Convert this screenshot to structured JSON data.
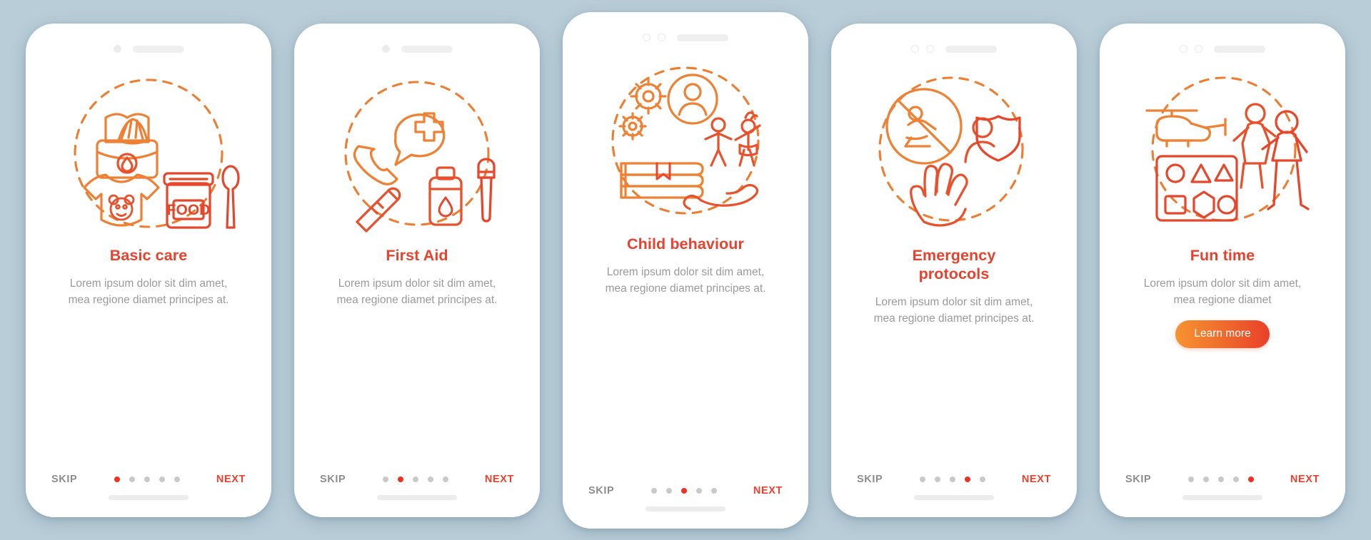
{
  "page": {
    "background_color": "#b8cdd8",
    "accent_color": "#e8422e",
    "muted_text_color": "#9a9a9a",
    "dot_active_color": "#ee3124",
    "dot_inactive_color": "#c9c9c9"
  },
  "common": {
    "skip_label": "SKIP",
    "next_label": "NEXT",
    "description": "Lorem ipsum dolor sit dim amet, mea regione diamet principes at.",
    "total_steps": 5
  },
  "screens": [
    {
      "index": 1,
      "title": "Basic care",
      "description": "Lorem ipsum dolor sit dim amet, mea regione diamet principes at.",
      "skip_label": "SKIP",
      "next_label": "NEXT",
      "active_dot": 1,
      "illustration": "baby-care-icon",
      "notch_style": "one-dot",
      "cta": null
    },
    {
      "index": 2,
      "title": "First Aid",
      "description": "Lorem ipsum dolor sit dim amet, mea regione diamet principes at.",
      "skip_label": "SKIP",
      "next_label": "NEXT",
      "active_dot": 2,
      "illustration": "first-aid-icon",
      "notch_style": "one-dot",
      "cta": null
    },
    {
      "index": 3,
      "title": "Child behaviour",
      "description": "Lorem ipsum dolor sit dim amet, mea regione diamet principes at.",
      "skip_label": "SKIP",
      "next_label": "NEXT",
      "active_dot": 3,
      "illustration": "child-behaviour-icon",
      "notch_style": "two-dots",
      "cta": null
    },
    {
      "index": 4,
      "title": "Emergency protocols",
      "description": "Lorem ipsum dolor sit dim amet, mea regione diamet principes at.",
      "skip_label": "SKIP",
      "next_label": "NEXT",
      "active_dot": 4,
      "illustration": "emergency-protocols-icon",
      "notch_style": "two-dots",
      "cta": null
    },
    {
      "index": 5,
      "title": "Fun time",
      "description": "Lorem ipsum dolor sit dim amet, mea regione diamet",
      "skip_label": "SKIP",
      "next_label": "NEXT",
      "active_dot": 5,
      "illustration": "fun-time-icon",
      "notch_style": "two-dots",
      "cta": "Learn more"
    }
  ]
}
